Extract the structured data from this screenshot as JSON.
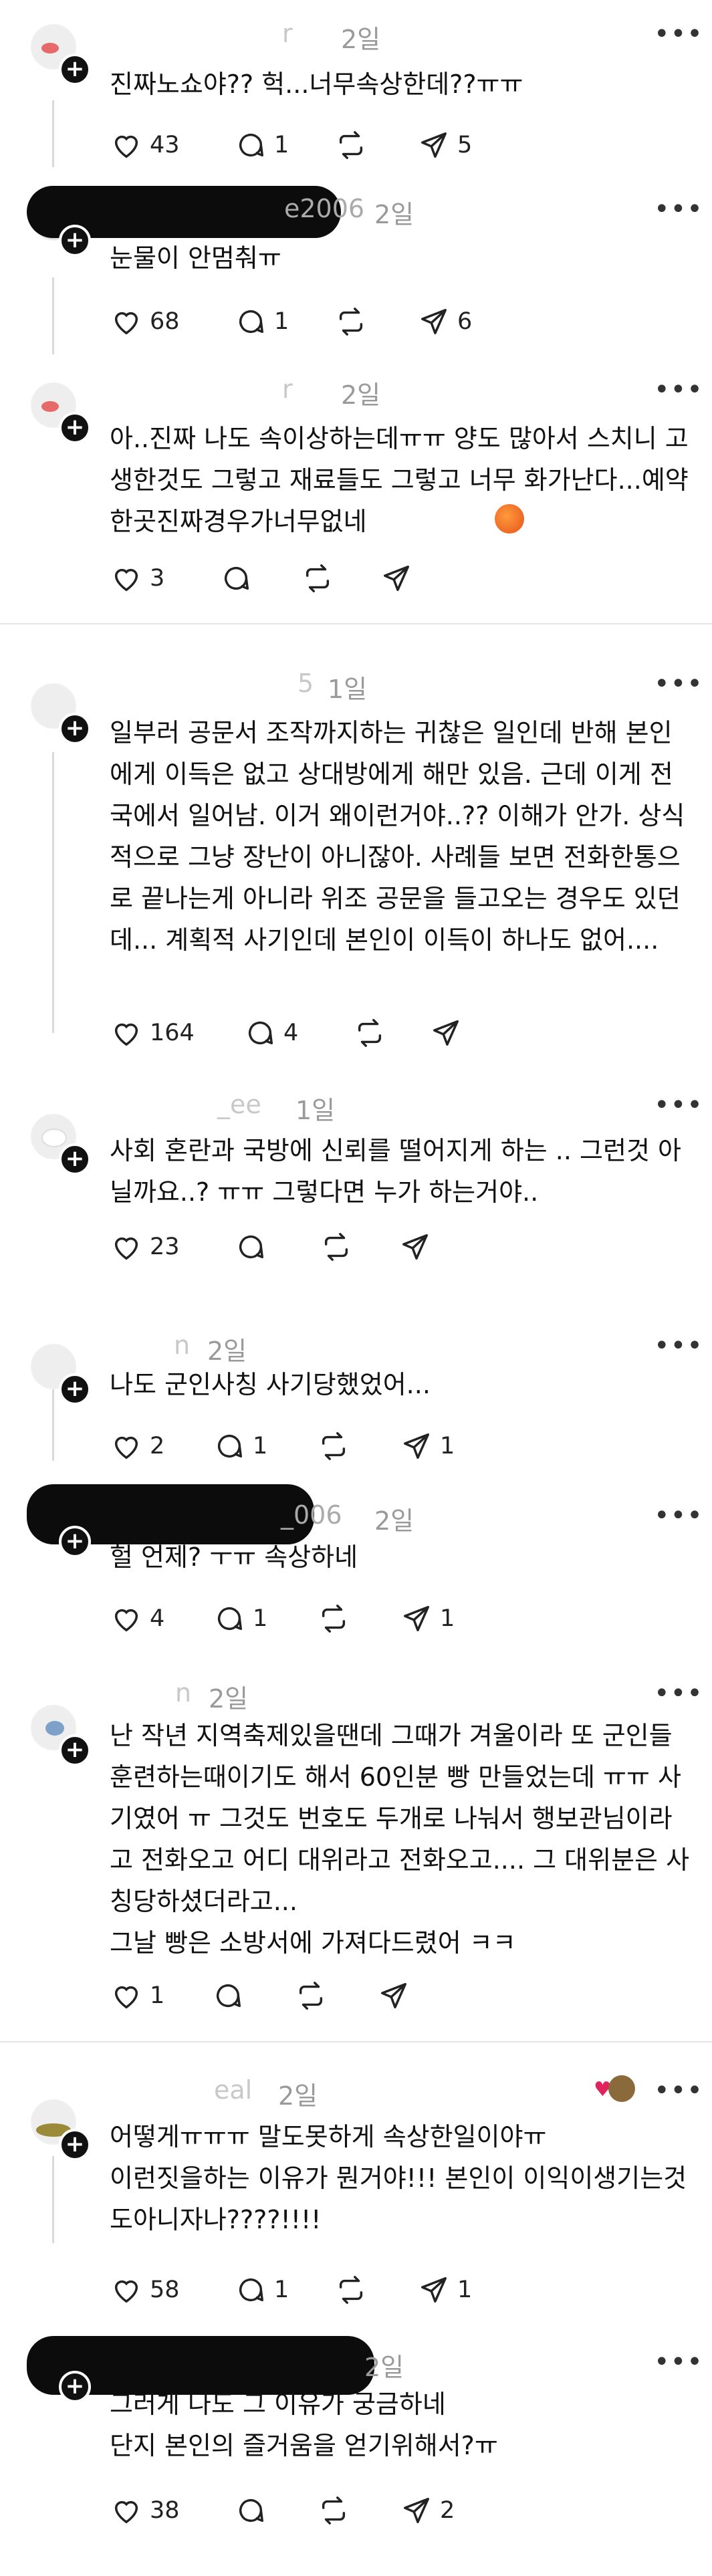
{
  "comments": [
    {
      "username": "r",
      "time": "2일",
      "text": "진짜노쇼야?? 헉...너무속상한데??ㅠㅠ",
      "likes": "43",
      "replies": "1",
      "reposts": "",
      "shares": "5"
    },
    {
      "username": "e2006",
      "time": "2일",
      "text": "눈물이 안멈춰ㅠ",
      "likes": "68",
      "replies": "1",
      "reposts": "",
      "shares": "6"
    },
    {
      "username": "r",
      "time": "2일",
      "text": "아..진짜 나도 속이상하는데ㅠㅠ 양도 많아서 스치니 고생한것도 그렇고 재료들도 그렇고 너무 화가난다...예약한곳진짜경우가너무없네",
      "likes": "3",
      "replies": "",
      "reposts": "",
      "shares": ""
    },
    {
      "username": "5",
      "time": "1일",
      "text": "일부러 공문서 조작까지하는 귀찮은 일인데 반해 본인에게 이득은 없고 상대방에게 해만 있음. 근데 이게 전국에서 일어남. 이거 왜이런거야..?? 이해가 안가. 상식적으로 그냥 장난이 아니잖아. 사례들 보면 전화한통으로 끝나는게 아니라 위조 공문을 들고오는 경우도 있던데... 계획적 사기인데 본인이 이득이 하나도 없어....",
      "likes": "164",
      "replies": "4",
      "reposts": "",
      "shares": ""
    },
    {
      "username": "_ee",
      "time": "1일",
      "text": "사회 혼란과 국방에 신뢰를 떨어지게 하는 .. 그런것 아닐까요..? ㅠㅠ 그렇다면 누가 하는거야..",
      "likes": "23",
      "replies": "",
      "reposts": "",
      "shares": ""
    },
    {
      "username": "n",
      "time": "2일",
      "text": "나도 군인사칭 사기당했었어...",
      "likes": "2",
      "replies": "1",
      "reposts": "",
      "shares": "1"
    },
    {
      "username": "_006",
      "time": "2일",
      "text": "헐 언제? ㅜㅠ 속상하네",
      "likes": "4",
      "replies": "1",
      "reposts": "",
      "shares": "1"
    },
    {
      "username": "n",
      "time": "2일",
      "text": "난 작년 지역축제있을땐데 그때가 겨울이라 또 군인들 훈련하는때이기도 해서 60인분 빵 만들었는데 ㅠㅠ 사기였어 ㅠ 그것도 번호도 두개로 나눠서 행보관님이라고 전화오고 어디 대위라고 전화오고.... 그 대위분은 사칭당하셨더라고...\n그날 빵은 소방서에 가져다드렸어 ㅋㅋ",
      "likes": "1",
      "replies": "",
      "reposts": "",
      "shares": ""
    },
    {
      "username": "eal",
      "time": "2일",
      "text": "어떻게ㅠㅠㅠ 말도못하게 속상한일이야ㅠ\n이런짓을하는 이유가 뭔거야!!! 본인이 이익이생기는것도아니자나????!!!!",
      "likes": "58",
      "replies": "1",
      "reposts": "",
      "shares": "1"
    },
    {
      "username": "",
      "time": "2일",
      "text": "그러게 나도 그 이유가 궁금하네\n단지 본인의 즐거움을 얻기위해서?ㅠ",
      "likes": "38",
      "replies": "",
      "reposts": "",
      "shares": "2"
    }
  ],
  "more_label": "•••",
  "plus_label": "+",
  "accent": "#111111",
  "icons": [
    "heart-icon",
    "comment-icon",
    "repost-icon",
    "share-icon",
    "more-icon",
    "plus-icon"
  ]
}
